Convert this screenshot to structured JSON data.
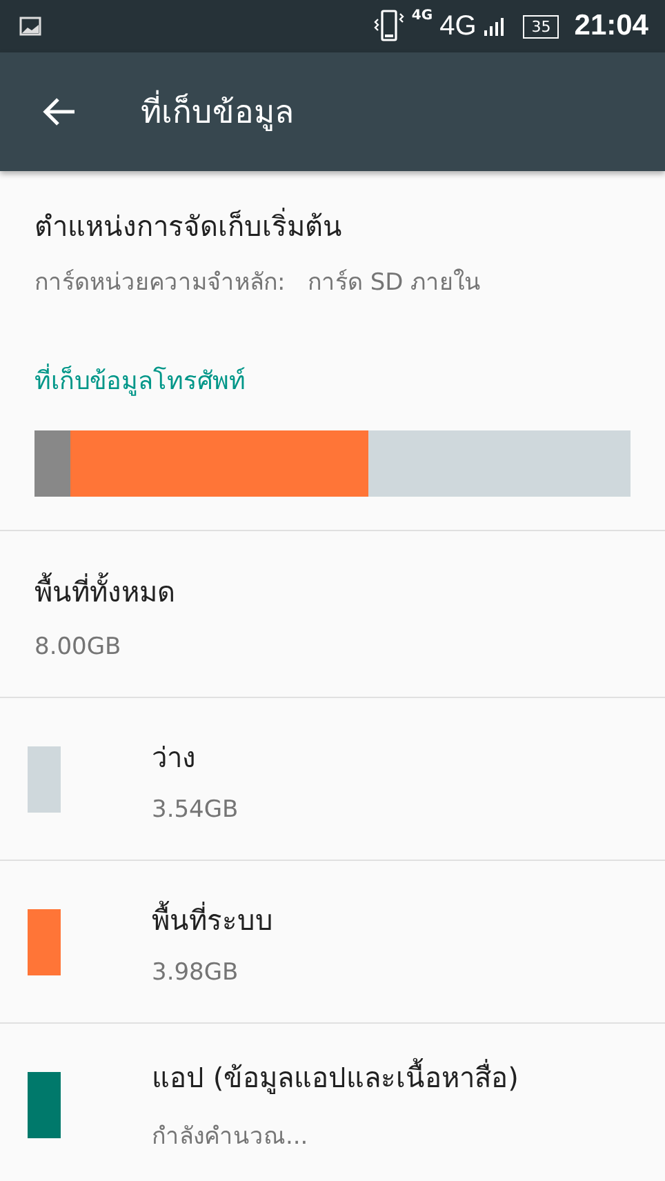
{
  "status_bar": {
    "network_small": "4G",
    "network": "4G",
    "battery": "35",
    "time": "21:04"
  },
  "toolbar": {
    "title": "ที่เก็บข้อมูล"
  },
  "default_location": {
    "title": "ตำแหน่งการจัดเก็บเริ่มต้น",
    "subtitle": "การ์ดหน่วยความจำหลัก:   การ์ด SD ภายใน"
  },
  "section": {
    "title": "ที่เก็บข้อมูลโทรศัพท์"
  },
  "usage_bar": [
    {
      "color": "#888888",
      "level": 0.06
    },
    {
      "color": "#ff7537",
      "level": 0.56
    }
  ],
  "total": {
    "title": "พื้นที่ทั้งหมด",
    "value": "8.00GB"
  },
  "legend": [
    {
      "label": "ว่าง",
      "value": "3.54GB",
      "color": "#cfd8dc"
    },
    {
      "label": "พื้นที่ระบบ",
      "value": "3.98GB",
      "color": "#ff7537"
    },
    {
      "label": "แอป (ข้อมูลแอปและเนื้อหาสื่อ)",
      "value": "กำลังคำนวณ...",
      "color": "#00796b"
    }
  ]
}
